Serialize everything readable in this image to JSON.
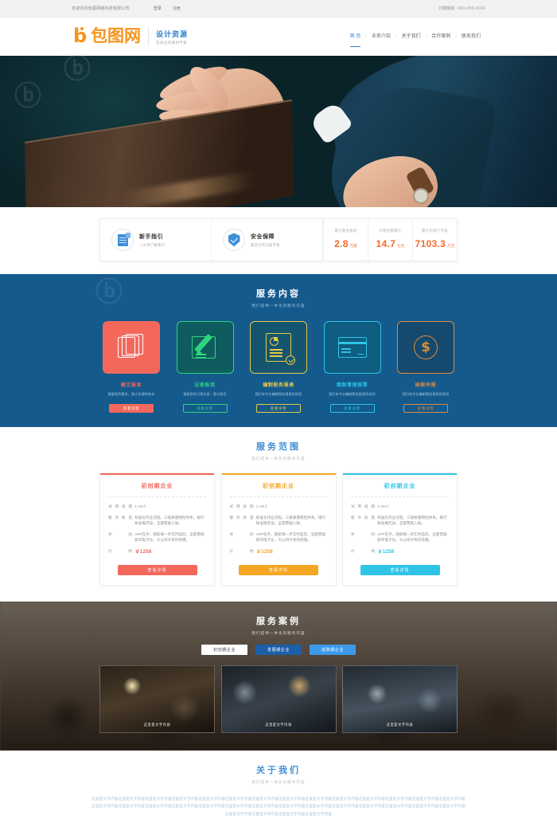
{
  "topbar": {
    "welcome": "欢迎访问包图网络科技有限公司",
    "login": "登录",
    "register": "注册",
    "hotline_label": "订购热线",
    "hotline_number": "000-000-0000"
  },
  "header": {
    "logo_text": "包图网",
    "logo_mark": "b",
    "slogan_title": "设计资源",
    "slogan_sub": "您身边的素材专家",
    "nav": [
      {
        "label": "首 页",
        "active": true
      },
      {
        "label": "业务介绍",
        "active": false
      },
      {
        "label": "关于我们",
        "active": false
      },
      {
        "label": "合作案例",
        "active": false
      },
      {
        "label": "联系我们",
        "active": false
      }
    ],
    "nav_separator": "/"
  },
  "stats": {
    "features": [
      {
        "icon": "document-icon",
        "title": "新手指引",
        "sub": "一分钟了解我们"
      },
      {
        "icon": "shield-check-icon",
        "title": "安全保障",
        "sub": "最安全的记账专家"
      }
    ],
    "numbers": [
      {
        "label": "累计服务商家",
        "value": "2.8",
        "unit": "万家"
      },
      {
        "label": "代理金额累计",
        "value": "14.7",
        "unit": "亿元"
      },
      {
        "label": "累计为客户节省",
        "value": "7103.3",
        "unit": "万元"
      }
    ]
  },
  "services": {
    "title": "服务内容",
    "subtitle": "我们提供一体化的服务内容",
    "accent": "#145a8d",
    "cards": [
      {
        "icon": "books-icon",
        "title": "建立账本",
        "desc": "根据您的需求，建立合理的账本",
        "button": "查看详情",
        "color": "#f4685c"
      },
      {
        "icon": "pencil-note-icon",
        "title": "记录账目",
        "desc": "根据您的日常交易，登记账目",
        "button": "查看详情",
        "color": "#2fd47f"
      },
      {
        "icon": "report-check-icon",
        "title": "编制税务报表",
        "desc": "我们有专业编制税务报表的经验",
        "button": "查看详情",
        "color": "#e8c84b"
      },
      {
        "icon": "invoice-icon",
        "title": "填制增值税票",
        "desc": "我们有专业编制税务报表的经验",
        "button": "查看详情",
        "color": "#2ec4e6"
      },
      {
        "icon": "coin-icon",
        "title": "纳税申报",
        "desc": "我们有专业编制税务报表的经验",
        "button": "查看详情",
        "color": "#e08a3c"
      }
    ]
  },
  "scope": {
    "title": "服务范围",
    "subtitle": "我们提供一体化的服务内容",
    "labels": {
      "scale": "试用规模",
      "quality": "服务质量",
      "experience": "体验",
      "price": "价格"
    },
    "colon": ":",
    "plans": [
      {
        "name": "初创期企业",
        "color": "#f4685c",
        "scale": "1~20人",
        "quality": "标准化作业流程，三级质量把控体系。银行账准确无误，全部票据入账。",
        "experience": "APP在手，随航每一步实时监控，全部票据影印电子化，大公司才有的待遇。",
        "price": "￥1258",
        "button": "查看详情"
      },
      {
        "name": "初创期企业",
        "color": "#f5a623",
        "scale": "1~20人",
        "quality": "标准化作业流程，三级质量把控体系。银行账准确无误，全部票据入账。",
        "experience": "APP在手，随航每一步实时监控，全部票据影印电子化，大公司才有的待遇。",
        "price": "￥1258",
        "button": "查看详情"
      },
      {
        "name": "初创期企业",
        "color": "#2ec4e6",
        "scale": "1~20人",
        "quality": "标准化作业流程，三级质量把控体系。银行账准确无误，全部票据入账。",
        "experience": "APP在手，随航每一步实时监控，全部票据影印电子化，大公司才有的待遇。",
        "price": "￥1258",
        "button": "查看详情"
      }
    ]
  },
  "cases": {
    "title": "服务案例",
    "subtitle": "我们提供一体化的服务内容",
    "tabs": [
      {
        "label": "初创期企业",
        "state": "active-light"
      },
      {
        "label": "发展期企业",
        "state": "dark"
      },
      {
        "label": "成熟期企业",
        "state": "blue"
      }
    ],
    "items": [
      {
        "caption": "这里是文字内容"
      },
      {
        "caption": "这里是文字内容"
      },
      {
        "caption": "这里是文字内容"
      }
    ]
  },
  "about": {
    "title": "关于我们",
    "subtitle": "我们提供一体化的服务内容",
    "body": "这里是文字内容这里是文字内容这里是文字内容这里是文字内容这里是文字内容这里是文字内容这里是文字内容这里是文字内容这里是文字内容这里是文字内容这里是文字内容这里是文字内容这里是文字内容这里是文字内容这里是文字内容这里是文字内容这里是文字内容这里是文字内容这里是文字内容这里是文字内容这里是文字内容这里是文字内容这里是文字内容这里是文字内容这里是文字内容这里是文字内容这里是文字内容这里是文字内容这里是文字内容这里是文字内容这里是文字内容这里是文字内容"
  },
  "watermark": {
    "text": "包图网"
  }
}
